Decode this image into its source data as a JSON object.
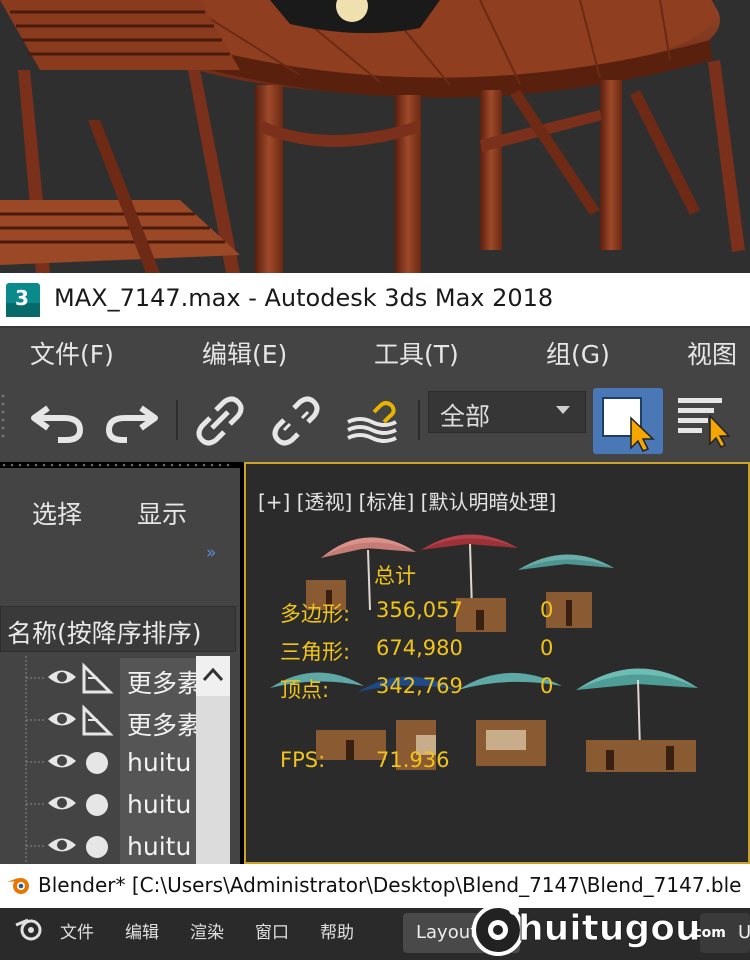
{
  "max_window": {
    "title": "MAX_7147.max - Autodesk 3ds Max 2018",
    "menu": [
      "文件(F)",
      "编辑(E)",
      "工具(T)",
      "组(G)",
      "视图"
    ],
    "toolbar": {
      "selection_filter_value": "全部"
    }
  },
  "scene_explorer": {
    "tabs": [
      "选择",
      "显示"
    ],
    "expand_glyph": "»",
    "sort_header": "名称(按降序排序)",
    "rows": [
      {
        "name": "更多素",
        "icon": "bone-icon"
      },
      {
        "name": "更多素",
        "icon": "bone-icon"
      },
      {
        "name": "huitu",
        "icon": "sphere-icon"
      },
      {
        "name": "huitu",
        "icon": "sphere-icon"
      },
      {
        "name": "huitu",
        "icon": "sphere-icon"
      }
    ]
  },
  "viewport": {
    "label": "[+] [透视] [标准] [默认明暗处理]",
    "stats": {
      "total_label": "总计",
      "polygons_label": "多边形:",
      "polygons_total": "356,057",
      "polygons_selected": "0",
      "triangles_label": "三角形:",
      "triangles_total": "674,980",
      "triangles_selected": "0",
      "vertices_label": "顶点:",
      "vertices_total": "342,769",
      "vertices_selected": "0",
      "fps_label": "FPS:",
      "fps_value": "71.936"
    }
  },
  "blender_window": {
    "title": "Blender* [C:\\Users\\Administrator\\Desktop\\Blend_7147\\Blend_7147.ble",
    "menu": [
      "文件",
      "编辑",
      "渲染",
      "窗口",
      "帮助"
    ],
    "layout_tab": "Layout",
    "layout_tab_extra": "U"
  },
  "watermark": {
    "brand": "huitugou",
    "suffix": ".com"
  },
  "colors": {
    "max_ui_bg": "#444444",
    "viewport_border": "#c9a227",
    "stats_text": "#f0c419",
    "active_button": "#4a78b7"
  }
}
